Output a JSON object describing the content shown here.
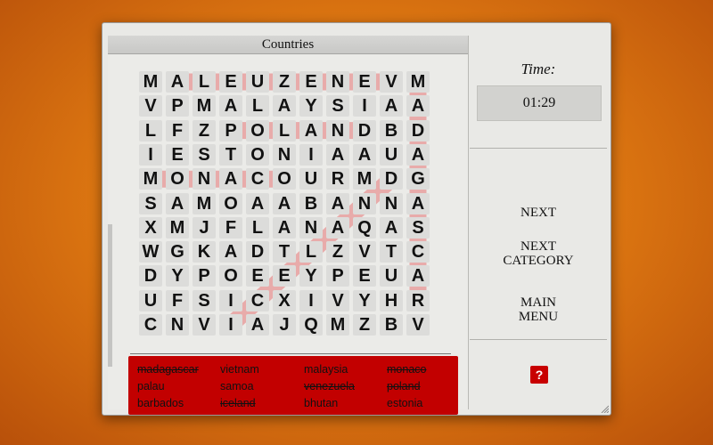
{
  "category": "Countries",
  "grid": [
    "MALEUZENEVM",
    "VPMALAYSIAA",
    "LFZPOLANDBD",
    "IESTONIAAUA",
    "MONACOURMDG",
    "SAMOAABANNA",
    "XMJFLANAQAS",
    "WGKADTLZVTC",
    "DYPOEEYPEUA",
    "UFSICXIVYHR",
    "CNVIAJQMZBV"
  ],
  "found_words": [
    {
      "word": "venezuela",
      "from": [
        0,
        9
      ],
      "to": [
        0,
        1
      ]
    },
    {
      "word": "poland",
      "from": [
        2,
        3
      ],
      "to": [
        2,
        8
      ]
    },
    {
      "word": "monaco",
      "from": [
        4,
        0
      ],
      "to": [
        4,
        5
      ]
    },
    {
      "word": "madagascar",
      "from": [
        0,
        10
      ],
      "to": [
        9,
        10
      ]
    },
    {
      "word": "iceland",
      "from": [
        10,
        3
      ],
      "to": [
        4,
        9
      ]
    }
  ],
  "highlight_color": "#e8a0a0",
  "word_list": [
    {
      "text": "madagascar",
      "found": true
    },
    {
      "text": "vietnam",
      "found": false
    },
    {
      "text": "malaysia",
      "found": false
    },
    {
      "text": "monaco",
      "found": true
    },
    {
      "text": "palau",
      "found": false
    },
    {
      "text": "samoa",
      "found": false
    },
    {
      "text": "venezuela",
      "found": true
    },
    {
      "text": "poland",
      "found": true
    },
    {
      "text": "barbados",
      "found": false
    },
    {
      "text": "iceland",
      "found": true
    },
    {
      "text": "bhutan",
      "found": false
    },
    {
      "text": "estonia",
      "found": false
    }
  ],
  "sidebar": {
    "time_label": "Time:",
    "time_value": "01:29",
    "next_label": "NEXT",
    "next_category_line1": "NEXT",
    "next_category_line2": "CATEGORY",
    "main_menu_line1": "MAIN",
    "main_menu_line2": "MENU",
    "help_label": "?"
  }
}
